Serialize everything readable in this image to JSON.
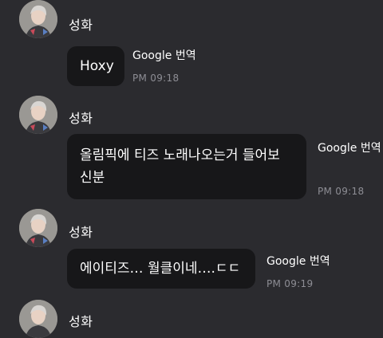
{
  "colors": {
    "background": "#2b2b2f",
    "bubble": "#171719",
    "meta_text": "#8d8d94"
  },
  "messages": [
    {
      "sender": "성화",
      "text_lines": [
        "Hoxy"
      ],
      "translate_label": "Google 번역",
      "time": "PM 09:18",
      "avatar_icon": "profile-photo"
    },
    {
      "sender": "성화",
      "text_lines": [
        "올림픽에 티즈 노래나오는거 들어보",
        "신분"
      ],
      "translate_label": "Google 번역",
      "time": "PM 09:18",
      "avatar_icon": "profile-photo"
    },
    {
      "sender": "성화",
      "text_lines": [
        "에이티즈… 월클이네….ㄷㄷ"
      ],
      "translate_label": "Google 번역",
      "time": "PM 09:19",
      "avatar_icon": "profile-photo"
    },
    {
      "sender": "성화",
      "avatar_icon": "profile-photo"
    }
  ]
}
